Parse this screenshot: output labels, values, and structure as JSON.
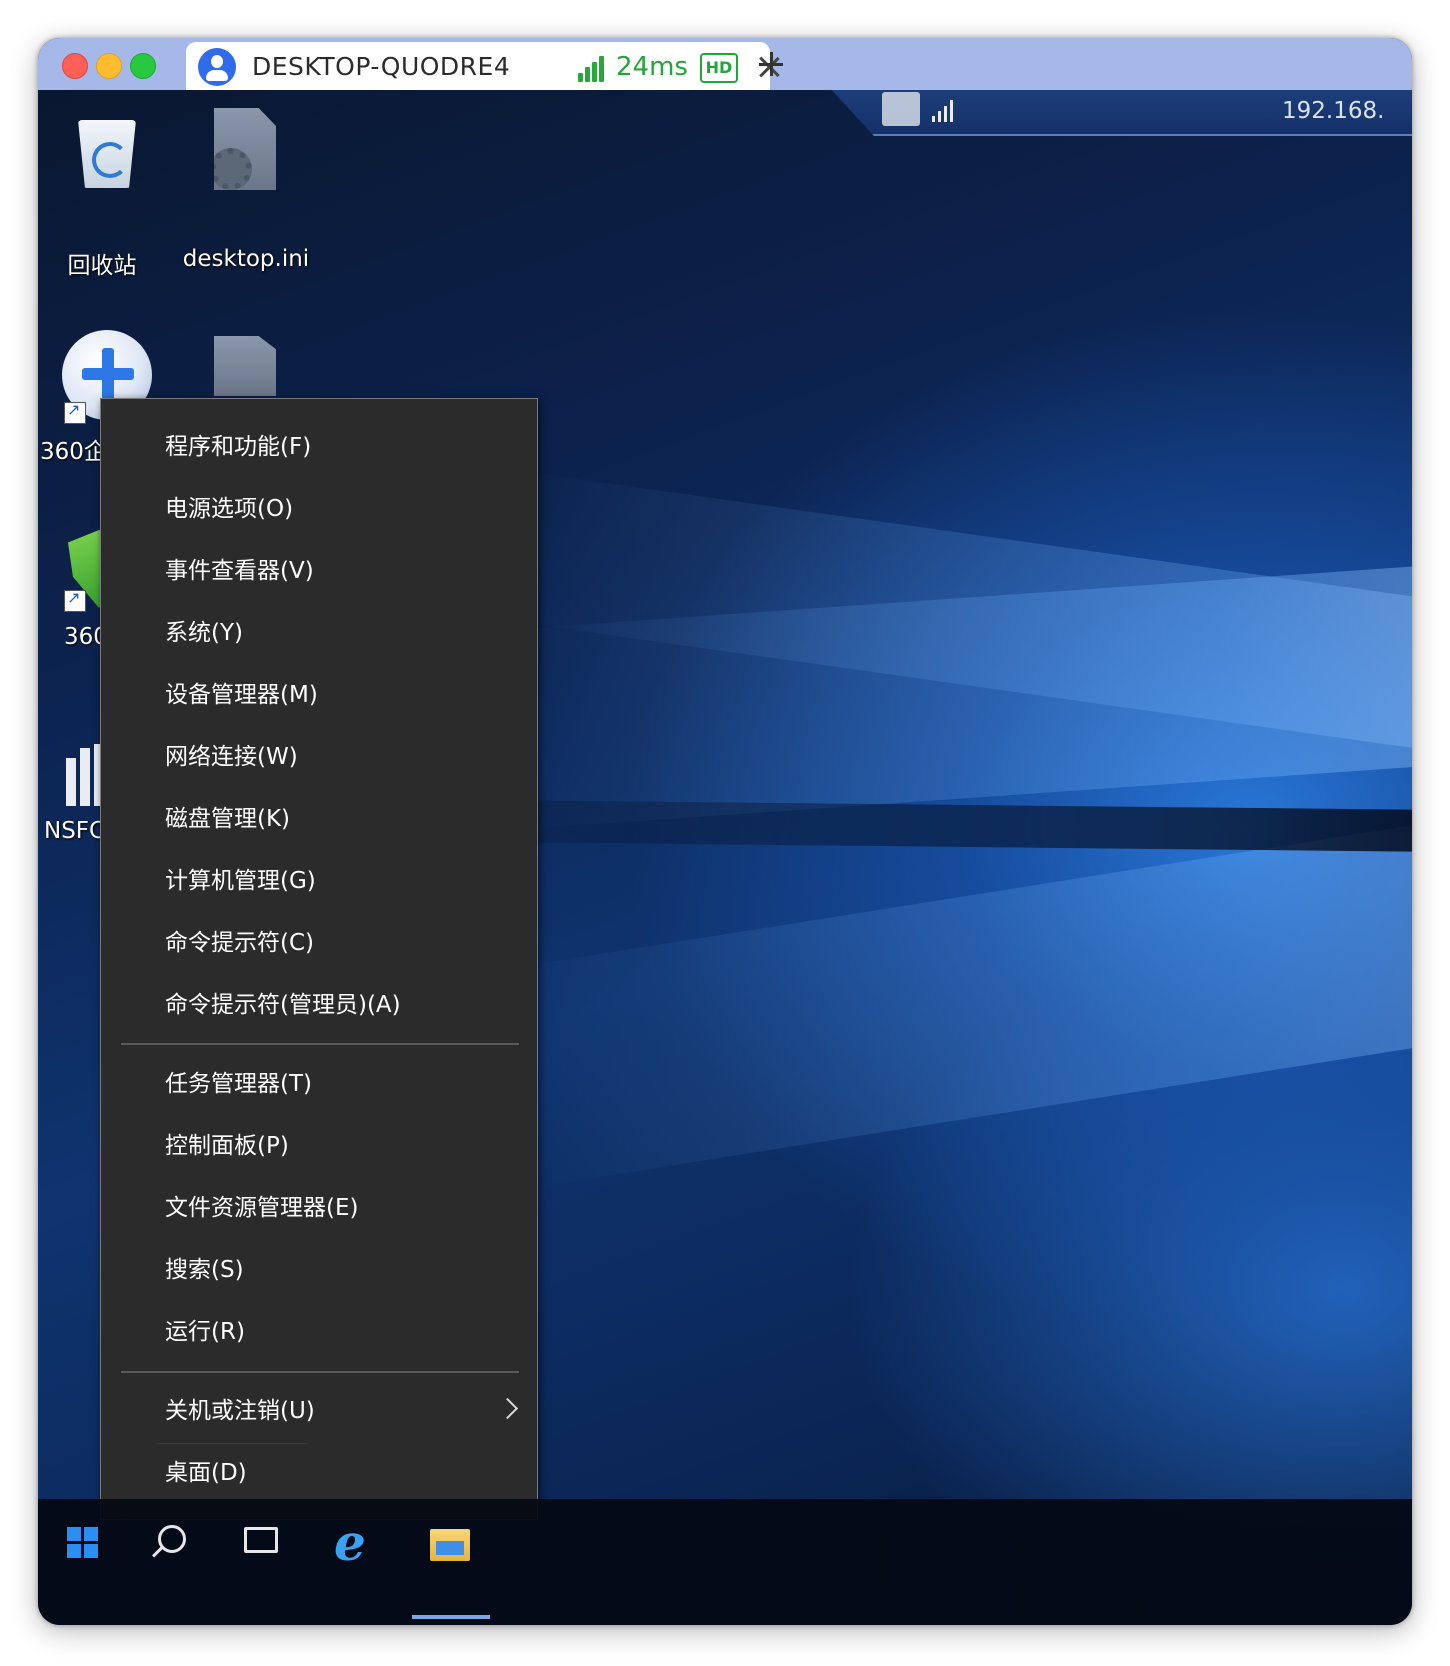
{
  "tab": {
    "title": "DESKTOP-QUODRE4",
    "latency": "24ms",
    "hd_badge": "HD"
  },
  "remote_bar": {
    "ip": "192.168."
  },
  "desktop": {
    "icons": [
      {
        "label": "回收站",
        "icon": "recycle-bin-icon"
      },
      {
        "label": "desktop.ini",
        "icon": "settings-file-icon"
      },
      {
        "label": "360企",
        "icon": "plus-circle-icon"
      },
      {
        "label": "360",
        "icon": "shield-icon"
      },
      {
        "label": "NSFC",
        "icon": "nsfc-icon"
      }
    ]
  },
  "context_menu": {
    "group1": [
      "程序和功能(F)",
      "电源选项(O)",
      "事件查看器(V)",
      "系统(Y)",
      "设备管理器(M)",
      "网络连接(W)",
      "磁盘管理(K)",
      "计算机管理(G)",
      "命令提示符(C)",
      "命令提示符(管理员)(A)"
    ],
    "group2": [
      "任务管理器(T)",
      "控制面板(P)",
      "文件资源管理器(E)",
      "搜索(S)",
      "运行(R)"
    ],
    "group3": [
      "关机或注销(U)",
      "桌面(D)"
    ]
  },
  "taskbar": {
    "items": [
      "start-icon",
      "search-icon",
      "task-view-icon",
      "edge-ie-icon",
      "file-explorer-icon"
    ]
  }
}
